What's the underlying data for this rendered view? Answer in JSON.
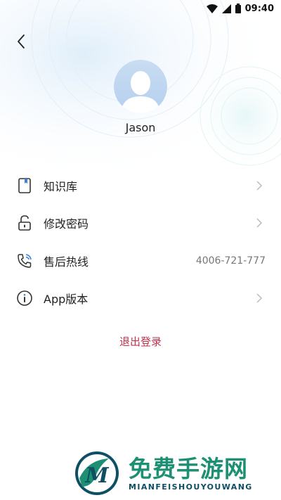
{
  "status_bar": {
    "time": "09:40"
  },
  "profile": {
    "name": "Jason"
  },
  "menu": [
    {
      "label": "知识库",
      "icon": "book-icon",
      "value": ""
    },
    {
      "label": "修改密码",
      "icon": "lock-icon",
      "value": ""
    },
    {
      "label": "售后热线",
      "icon": "phone-icon",
      "value": "4006-721-777"
    },
    {
      "label": "App版本",
      "icon": "info-icon",
      "value": ""
    }
  ],
  "logout": {
    "label": "退出登录"
  },
  "colors": {
    "logout": "#c0334d",
    "watermark_green": "#1d8f72",
    "watermark_dark": "#0e4f63"
  },
  "watermark": {
    "title": "免费手游网",
    "subtitle": "MIANFEISHOUYOUWANG",
    "logo_letter": "M"
  }
}
